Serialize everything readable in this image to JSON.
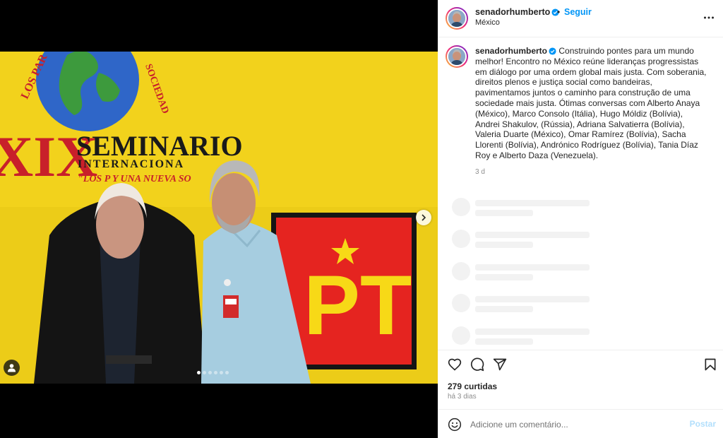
{
  "post": {
    "username": "senadorhumberto",
    "follow_label": "Seguir",
    "separator": "•",
    "location": "México",
    "caption": "Construindo pontes para um mundo melhor! Encontro no México reúne lideranças progressistas em diálogo por uma ordem global mais justa. Com soberania, direitos plenos e justiça social como bandeiras, pavimentamos juntos o caminho para construção de uma sociedade mais justa. Ótimas conversas com Alberto Anaya (México), Marco Consolo (Itália), Hugo Móldiz (Bolívia), Andrei Shakulov, (Rússia), Adriana Salvatierra (Bolívia), Valeria Duarte (México), Omar Ramírez (Bolívia), Sacha Llorenti (Bolívia), Andrónico Rodríguez (Bolívia), Tania Díaz Roy e Alberto Daza (Venezuela).",
    "caption_time": "3 d",
    "likes": "279 curtidas",
    "posted_ago": "há 3 dias"
  },
  "photo": {
    "banner_top_left": "LOS PAR",
    "banner_top_right": "SOCIEDAD",
    "roman_numeral": "XIX",
    "banner_title": "SEMINARIO",
    "banner_subtitle": "INTERNACIONA",
    "banner_quote": "\"LOS P         Y UNA NUEVA SO",
    "party_logo": "PT",
    "colors": {
      "background": "#f2d21c",
      "party_red": "#e52420",
      "party_yellow": "#f7d917"
    }
  },
  "carousel": {
    "slides": 6,
    "active": 0
  },
  "comment": {
    "placeholder": "Adicione um comentário...",
    "post_label": "Postar"
  },
  "colors": {
    "accent": "#0095f6",
    "post_disabled": "#b2dffc",
    "verified": "#0095f6"
  },
  "icons": [
    "verified-badge-icon",
    "more-options-icon",
    "next-slide-icon",
    "tagged-user-icon",
    "heart-icon",
    "comment-icon",
    "share-icon",
    "save-bookmark-icon",
    "emoji-icon"
  ]
}
